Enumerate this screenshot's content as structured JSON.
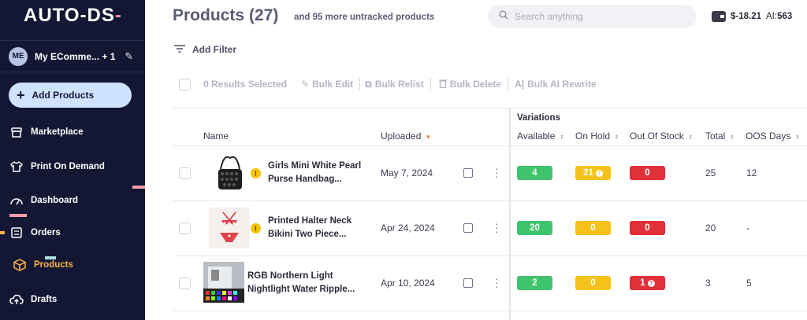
{
  "sidebar": {
    "logo": {
      "part1": "AUT",
      "part2": "O",
      "part3": "-DS",
      "part4": "-"
    },
    "store": {
      "avatar": "ME",
      "name": "My EComme... + 1"
    },
    "add_products": "Add Products",
    "items": [
      {
        "label": "Marketplace",
        "icon": "store-icon"
      },
      {
        "label": "Print On Demand",
        "icon": "tshirt-icon"
      },
      {
        "label": "Dashboard",
        "icon": "gauge-icon"
      },
      {
        "label": "Orders",
        "icon": "list-icon"
      },
      {
        "label": "Products",
        "icon": "box-icon",
        "active": true
      },
      {
        "label": "Drafts",
        "icon": "cloud-upload-icon"
      }
    ]
  },
  "header": {
    "title": "Products",
    "count": "(27)",
    "subtitle": "and 95 more untracked products",
    "search_placeholder": "Search anything",
    "balance": "$-18.21",
    "ai_label": "AI:",
    "ai_value": "563"
  },
  "filter": {
    "label": "Add Filter"
  },
  "bulk": {
    "selected": "0 Results Selected",
    "edit": "Bulk Edit",
    "relist": "Bulk Relist",
    "delete": "Bulk Delete",
    "ai_rewrite": "Bulk AI Rewrite"
  },
  "table": {
    "columns": {
      "name": "Name",
      "uploaded": "Uploaded",
      "variations": "Variations",
      "available": "Available",
      "on_hold": "On Hold",
      "out_of_stock": "Out Of Stock",
      "total": "Total",
      "oos_days": "OOS Days"
    },
    "rows": [
      {
        "name": "Girls Mini White Pearl Purse Handbag...",
        "uploaded": "May 7, 2024",
        "warning": true,
        "available": "4",
        "on_hold": "21",
        "out_of_stock": "0",
        "total": "25",
        "oos_days": "12"
      },
      {
        "name": "Printed Halter Neck Bikini Two Piece...",
        "uploaded": "Apr 24, 2024",
        "warning": true,
        "available": "20",
        "on_hold": "0",
        "out_of_stock": "0",
        "total": "20",
        "oos_days": "-"
      },
      {
        "name": "RGB Northern Light Nightlight Water Ripple...",
        "uploaded": "Apr 10, 2024",
        "warning": false,
        "available": "2",
        "on_hold": "0",
        "out_of_stock": "1",
        "total": "3",
        "oos_days": "5"
      }
    ]
  },
  "colors": {
    "sidebar_bg": "#131733",
    "active_nav": "#ffb347",
    "available": "#3fc36b",
    "on_hold": "#f5c21b",
    "out_of_stock": "#e0303a"
  }
}
